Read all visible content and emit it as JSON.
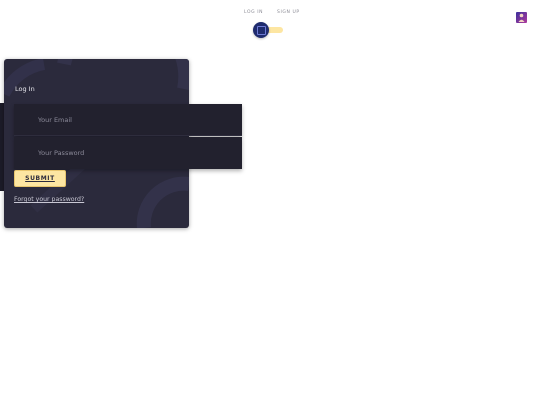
{
  "nav": {
    "login_tab": "LOG IN",
    "signup_tab": "SIGN UP"
  },
  "form": {
    "title": "Log In",
    "email_placeholder": "Your Email",
    "password_placeholder": "Your Password",
    "submit_label": "SUBMIT",
    "forgot_link": "Forgot your password?"
  },
  "theme": {
    "card_bg": "#2b2a3c",
    "field_bg": "#22212e",
    "accent": "#fde6a2",
    "toggle_knob": "#1f2b6e"
  },
  "icons": {
    "theme_toggle": "toggle-switch-icon",
    "avatar": "user-avatar-icon"
  }
}
